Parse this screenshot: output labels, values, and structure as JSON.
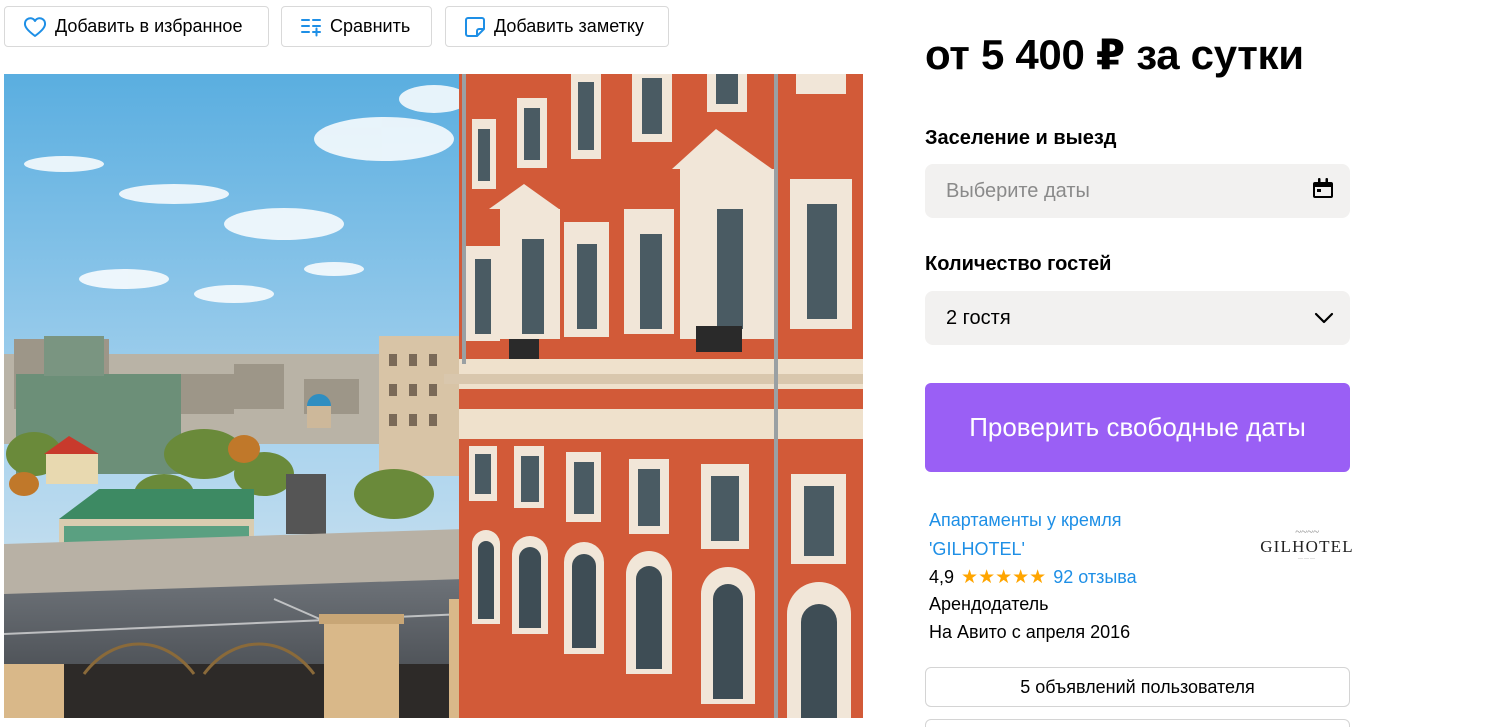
{
  "actions": {
    "favorite_label": "Добавить в избранное",
    "compare_label": "Сравнить",
    "note_label": "Добавить заметку"
  },
  "booking": {
    "price": "от 5 400 ₽ за сутки",
    "dates_label": "Заселение и выезд",
    "dates_placeholder": "Выберите даты",
    "guests_label": "Количество гостей",
    "guests_value": "2 гостя",
    "check_button": "Проверить свободные даты"
  },
  "seller": {
    "name": "Апартаменты у кремля 'GILHOTEL'",
    "rating": "4,9",
    "stars": 5,
    "stars_text": "★★★★★",
    "reviews": "92 отзыва",
    "role": "Арендодатель",
    "since": "На Авито с апреля 2016",
    "logo_text": "GILHOTEL",
    "listings_button": "5 объявлений пользователя"
  },
  "colors": {
    "accent_purple": "#9a5ff5",
    "link_blue": "#1e8fe6",
    "star_orange": "#ffa500",
    "field_bg": "#f2f1f0"
  },
  "icons": {
    "favorite": "heart-icon",
    "compare": "compare-icon",
    "note": "note-icon",
    "dates": "calendar-icon",
    "guests": "chevron-down-icon"
  }
}
